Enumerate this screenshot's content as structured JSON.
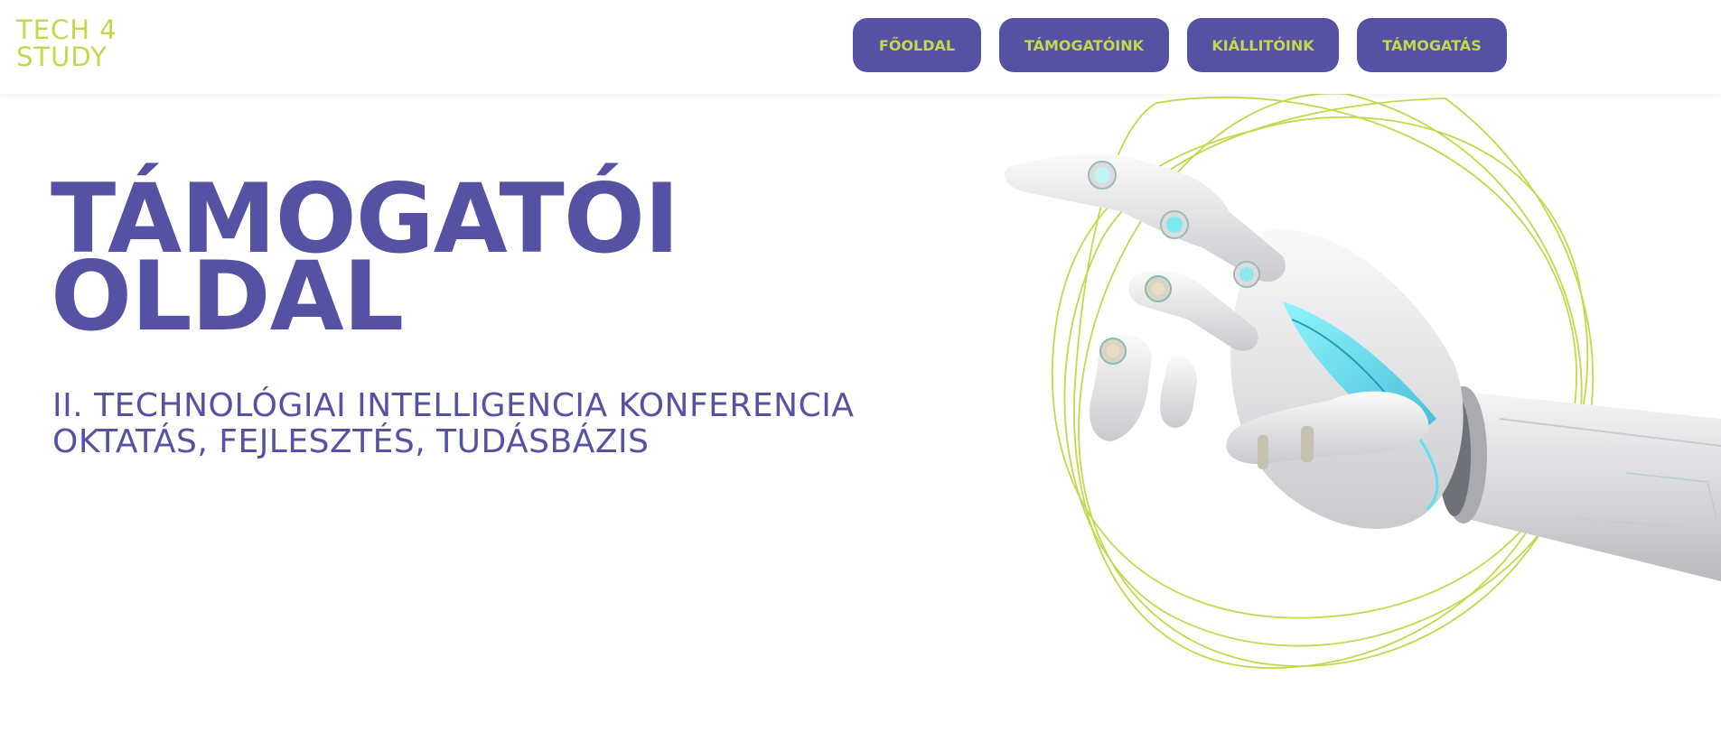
{
  "logo": {
    "line1": "TECH 4",
    "line2": "STUDY"
  },
  "nav": {
    "items": [
      {
        "label": "FŐOLDAL"
      },
      {
        "label": "TÁMOGATÓINK"
      },
      {
        "label": "KIÁLLITÓINK"
      },
      {
        "label": "TÁMOGATÁS"
      }
    ]
  },
  "hero": {
    "title_line1": "TÁMOGATÓI",
    "title_line2": "OLDAL",
    "subtitle_line1": "II. TECHNOLÓGIAI INTELLIGENCIA KONFERENCIA",
    "subtitle_line2": "OKTATÁS, FEJLESZTÉS, TUDÁSBÁZIS"
  },
  "colors": {
    "brand_purple": "#5652a3",
    "brand_lime": "#c3d84a",
    "background": "#ffffff"
  },
  "illustration": {
    "icon": "robot-hand-illustration"
  }
}
